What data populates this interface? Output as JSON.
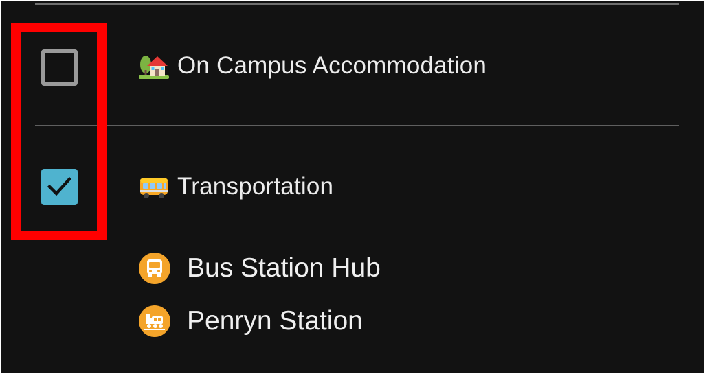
{
  "layers": [
    {
      "label": "On Campus Accommodation",
      "checked": false,
      "icon": "house-with-garden-icon"
    },
    {
      "label": "Transportation",
      "checked": true,
      "icon": "bus-icon",
      "items": [
        {
          "label": "Bus Station Hub",
          "icon": "bus-marker-icon"
        },
        {
          "label": "Penryn Station",
          "icon": "train-marker-icon"
        }
      ]
    }
  ],
  "colors": {
    "background": "#121212",
    "checkbox_checked": "#4fb3cf",
    "checkbox_unchecked_border": "#9a9a9a",
    "marker": "#f4a42a",
    "highlight": "#ff0000"
  }
}
